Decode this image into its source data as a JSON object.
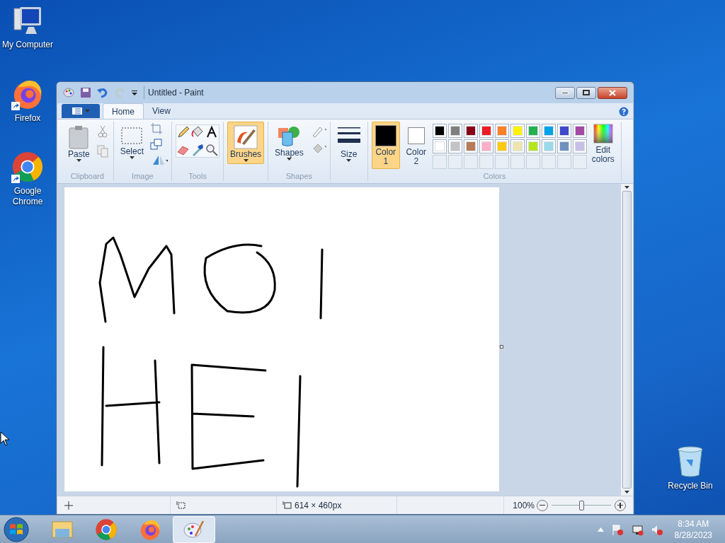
{
  "desktop_icons": [
    {
      "label": "My Computer",
      "kind": "computer"
    },
    {
      "label": "Firefox",
      "kind": "firefox"
    },
    {
      "label": "Google Chrome",
      "kind": "chrome"
    },
    {
      "label": "Recycle Bin",
      "kind": "bin"
    }
  ],
  "window": {
    "title": "Untitled - Paint"
  },
  "tabs": [
    {
      "label": "Home",
      "selected": true
    },
    {
      "label": "View",
      "selected": false
    }
  ],
  "groups": [
    {
      "label": "Clipboard",
      "kind": "clipboard",
      "tool": "Paste"
    },
    {
      "label": "Image",
      "kind": "image",
      "tool": "Select"
    },
    {
      "label": "Tools",
      "kind": "tools"
    },
    {
      "kind": "brushes",
      "tool": "Brushes",
      "selected": true
    },
    {
      "label": "Shapes",
      "kind": "shapes",
      "tool": "Shapes"
    },
    {
      "kind": "size",
      "tool": "Size"
    }
  ],
  "colors": {
    "label": "Colors",
    "color1": {
      "label": "Color 1",
      "selected": true,
      "color": "#000000"
    },
    "color2": {
      "label": "Color 2",
      "selected": false,
      "color": "#ffffff"
    },
    "edit": "Edit colors",
    "palette": [
      {
        "swatches": [
          {
            "color": "#000000"
          },
          {
            "color": "#7f7f7f"
          },
          {
            "color": "#880015"
          },
          {
            "color": "#ed1c24"
          },
          {
            "color": "#ff7f27"
          },
          {
            "color": "#fff200"
          },
          {
            "color": "#22b14c"
          },
          {
            "color": "#00a2e8"
          },
          {
            "color": "#3f48cc"
          },
          {
            "color": "#a349a4"
          }
        ]
      },
      {
        "swatches": [
          {
            "color": "#ffffff"
          },
          {
            "color": "#c3c3c3"
          },
          {
            "color": "#b97a57"
          },
          {
            "color": "#ffaec9"
          },
          {
            "color": "#ffc90e"
          },
          {
            "color": "#efe4b0"
          },
          {
            "color": "#b5e61d"
          },
          {
            "color": "#99d9ea"
          },
          {
            "color": "#7092be"
          },
          {
            "color": "#c8bfe7"
          }
        ]
      }
    ]
  },
  "status_bar": {
    "size": "614 × 460px",
    "zoom": "100%",
    "zoom_slider": {
      "level": 0.5
    }
  },
  "taskbar": {
    "apps": [
      {
        "kind": "explorer",
        "selected": false
      },
      {
        "kind": "chrome",
        "selected": false
      },
      {
        "kind": "firefox",
        "selected": false
      },
      {
        "kind": "paint",
        "selected": true
      }
    ],
    "time": "8:34 AM",
    "date": "8/28/2023"
  }
}
